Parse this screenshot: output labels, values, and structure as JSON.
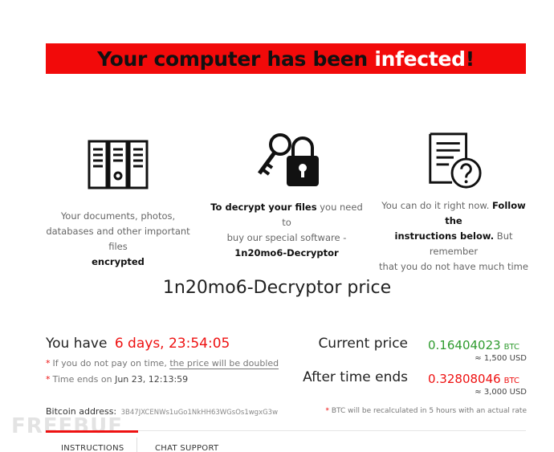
{
  "banner": {
    "text_before": "Your computer has been ",
    "highlight": "infected",
    "text_after": "!"
  },
  "features": [
    {
      "icon": "server-files-icon",
      "line1": "Your documents, photos,",
      "line2": "databases and other important files",
      "bold3": "encrypted"
    },
    {
      "icon": "key-lock-icon",
      "bold1": "To decrypt your files",
      "line1b": " you need to",
      "line2": "buy our special software -",
      "bold3": "1n20mo6-Decryptor"
    },
    {
      "icon": "document-question-icon",
      "line1a": "You can do it right now. ",
      "bold1": "Follow the",
      "bold2": "instructions below.",
      "line2b": " But remember",
      "line3": "that you do not have much time"
    }
  ],
  "price_title": "1n20mo6-Decryptor price",
  "countdown": {
    "label": "You have",
    "timer": "6 days, 23:54:05"
  },
  "notes": {
    "double_prefix": "If you do not pay on time, ",
    "double_link": "the price will be doubled",
    "time_ends_label": "Time ends on ",
    "time_ends_value": "Jun 23, 12:13:59"
  },
  "current_price": {
    "label": "Current price",
    "value": "0.16404023",
    "currency": "BTC",
    "usd": "≈ 1,500 USD"
  },
  "after_price": {
    "label": "After time ends",
    "value": "0.32808046",
    "currency": "BTC",
    "usd": "≈ 3,000 USD"
  },
  "bitcoin": {
    "label": "Bitcoin address:",
    "address": "3B47JXCENWs1uGo1NkHH63WGsOs1wgxG3w"
  },
  "recalc_note": "BTC will be recalculated in 5 hours with an actual rate",
  "tabs": [
    {
      "label": "INSTRUCTIONS"
    },
    {
      "label": "CHAT SUPPORT"
    }
  ],
  "watermark": "FREEBUF",
  "colors": {
    "accent": "#f20a0a",
    "green": "#2e9b2e",
    "red": "#ee1111"
  }
}
